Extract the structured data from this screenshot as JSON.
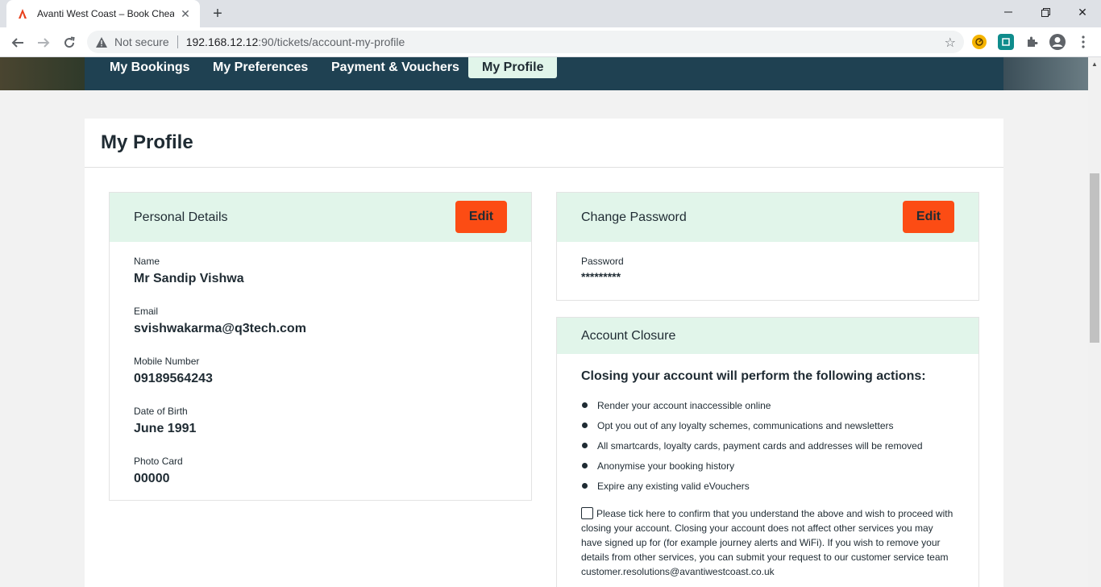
{
  "browser": {
    "tab_title": "Avanti West Coast – Book Cheap",
    "tab_favicon": "avanti-logo-icon",
    "security_text": "Not secure",
    "url_host": "192.168.12.12",
    "url_path": ":90/tickets/account-my-profile"
  },
  "nav": {
    "items": [
      {
        "label": "My Bookings"
      },
      {
        "label": "My Preferences"
      },
      {
        "label": "Payment & Vouchers"
      },
      {
        "label": "My Profile"
      }
    ],
    "active": "My Profile"
  },
  "page_title": "My Profile",
  "personal_details": {
    "title": "Personal Details",
    "edit_label": "Edit",
    "fields": [
      {
        "label": "Name",
        "value": "Mr Sandip Vishwa"
      },
      {
        "label": "Email",
        "value": "svishwakarma@q3tech.com"
      },
      {
        "label": "Mobile Number",
        "value": "09189564243"
      },
      {
        "label": "Date of Birth",
        "value": "June 1991"
      },
      {
        "label": "Photo Card",
        "value": "00000"
      }
    ]
  },
  "change_password": {
    "title": "Change Password",
    "edit_label": "Edit",
    "password_label": "Password",
    "password_value": "*********"
  },
  "account_closure": {
    "title": "Account Closure",
    "heading": "Closing your account will perform the following actions:",
    "actions": [
      "Render your account inaccessible online",
      "Opt you out of any loyalty schemes, communications and newsletters",
      "All smartcards, loyalty cards, payment cards and addresses will be removed",
      "Anonymise your booking history",
      "Expire any existing valid eVouchers"
    ],
    "confirm_text": "Please tick here to confirm that you understand the above and wish to proceed with closing your account. Closing your account does not affect other services you may have signed up for (for example journey alerts and WiFi). If you wish to remove your details from other services, you can submit your request to our customer service team customer.resolutions@avantiwestcoast.co.uk",
    "confirm_checked": false
  },
  "colors": {
    "nav_bg": "#1f4152",
    "active_tab_bg": "#e1f5ea",
    "panel_head_bg": "#e1f5ea",
    "edit_button": "#fc4c14",
    "text": "#1f2b33"
  }
}
